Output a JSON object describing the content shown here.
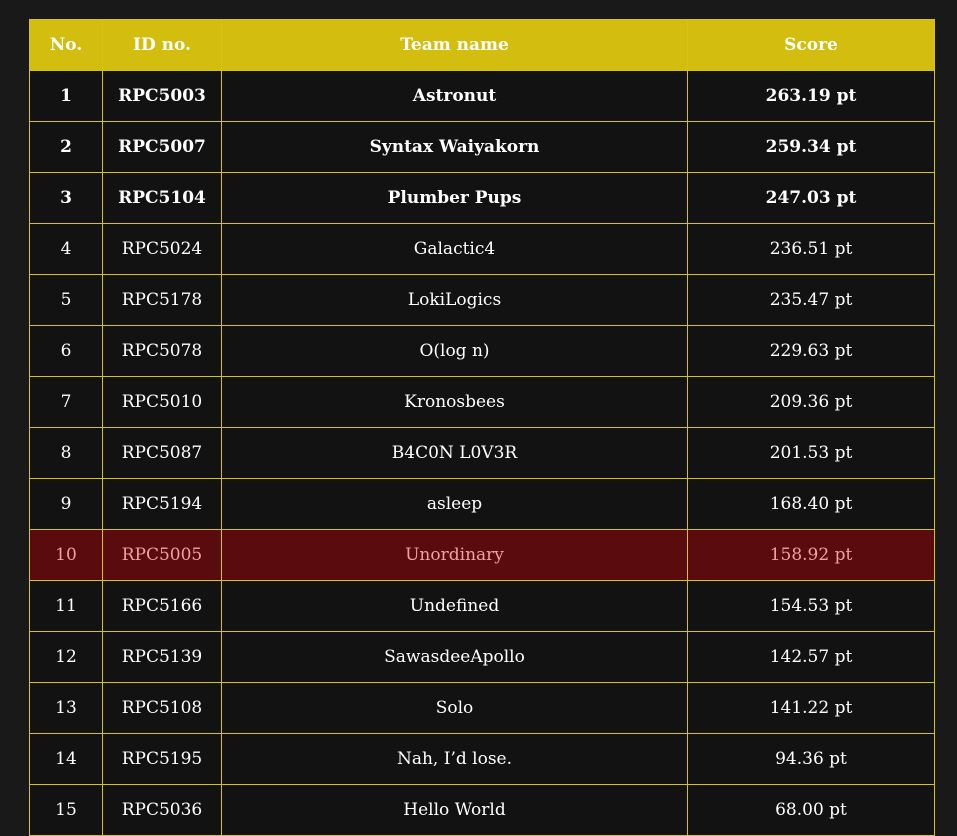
{
  "table": {
    "headers": [
      "No.",
      "ID no.",
      "Team name",
      "Score"
    ],
    "rows": [
      {
        "no": "1",
        "id": "RPC5003",
        "team": "Astronut",
        "score": "263.19 pt",
        "bold": true,
        "highlight": false
      },
      {
        "no": "2",
        "id": "RPC5007",
        "team": "Syntax Waiyakorn",
        "score": "259.34 pt",
        "bold": true,
        "highlight": false
      },
      {
        "no": "3",
        "id": "RPC5104",
        "team": "Plumber Pups",
        "score": "247.03 pt",
        "bold": true,
        "highlight": false
      },
      {
        "no": "4",
        "id": "RPC5024",
        "team": "Galactic4",
        "score": "236.51 pt",
        "bold": false,
        "highlight": false
      },
      {
        "no": "5",
        "id": "RPC5178",
        "team": "LokiLogics",
        "score": "235.47 pt",
        "bold": false,
        "highlight": false
      },
      {
        "no": "6",
        "id": "RPC5078",
        "team": "O(log n)",
        "score": "229.63 pt",
        "bold": false,
        "highlight": false
      },
      {
        "no": "7",
        "id": "RPC5010",
        "team": "Kronosbees",
        "score": "209.36 pt",
        "bold": false,
        "highlight": false
      },
      {
        "no": "8",
        "id": "RPC5087",
        "team": "B4C0N L0V3R",
        "score": "201.53 pt",
        "bold": false,
        "highlight": false
      },
      {
        "no": "9",
        "id": "RPC5194",
        "team": "asleep",
        "score": "168.40 pt",
        "bold": false,
        "highlight": false
      },
      {
        "no": "10",
        "id": "RPC5005",
        "team": "Unordinary",
        "score": "158.92 pt",
        "bold": false,
        "highlight": true
      },
      {
        "no": "11",
        "id": "RPC5166",
        "team": "Undefined",
        "score": "154.53 pt",
        "bold": false,
        "highlight": false
      },
      {
        "no": "12",
        "id": "RPC5139",
        "team": "SawasdeeApollo",
        "score": "142.57 pt",
        "bold": false,
        "highlight": false
      },
      {
        "no": "13",
        "id": "RPC5108",
        "team": "Solo",
        "score": "141.22 pt",
        "bold": false,
        "highlight": false
      },
      {
        "no": "14",
        "id": "RPC5195",
        "team": "Nah, I’d lose.",
        "score": "94.36 pt",
        "bold": false,
        "highlight": false
      },
      {
        "no": "15",
        "id": "RPC5036",
        "team": "Hello World",
        "score": "68.00 pt",
        "bold": false,
        "highlight": false
      }
    ]
  },
  "colors": {
    "header_bg": "#d3bd0e",
    "border": "#d6c21a",
    "row_bg": "#121212",
    "highlight_bg": "#5a0b0d",
    "highlight_text": "#f2a0a0"
  }
}
